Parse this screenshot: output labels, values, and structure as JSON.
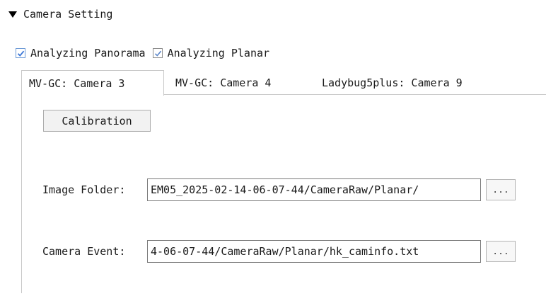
{
  "section": {
    "title": "Camera Setting",
    "expanded": true
  },
  "checkboxes": [
    {
      "label": "Analyzing Panorama",
      "checked": true
    },
    {
      "label": "Analyzing Planar",
      "checked": true
    }
  ],
  "tabs": [
    {
      "label": "MV-GC: Camera 3",
      "active": true
    },
    {
      "label": "MV-GC: Camera 4",
      "active": false
    },
    {
      "label": "Ladybug5plus: Camera 9",
      "active": false
    }
  ],
  "panel": {
    "calibration_label": "Calibration",
    "image_folder": {
      "label": "Image Folder:",
      "value": "EM05_2025-02-14-06-07-44/CameraRaw/Planar/",
      "browse_label": "..."
    },
    "camera_event": {
      "label": "Camera Event:",
      "value": "4-06-07-44/CameraRaw/Planar/hk_caminfo.txt",
      "browse_label": "..."
    }
  },
  "colors": {
    "checkbox_accent": "#3c78d8",
    "border": "#c8c8c8",
    "button_bg": "#f2f2f2"
  }
}
